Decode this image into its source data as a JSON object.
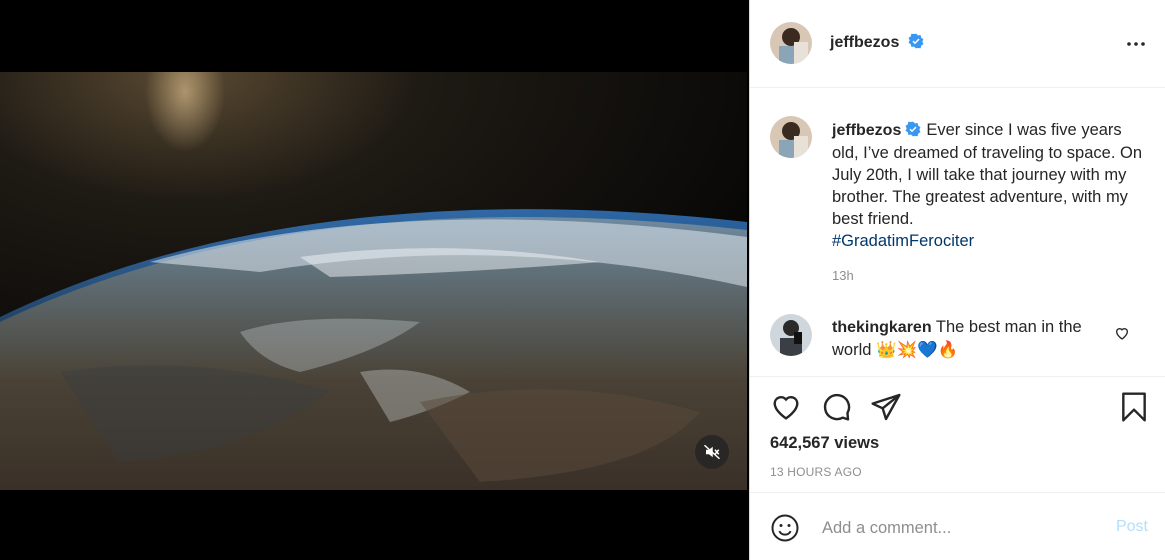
{
  "post": {
    "username": "jeffbezos",
    "verified": true,
    "caption_username": "jeffbezos",
    "caption_text": "Ever since I was five years old, I’ve dreamed of traveling to space. On July 20th, I will take that journey with my brother. The greatest adventure, with my best friend.",
    "hashtag": "#GradatimFerociter",
    "time": "13h",
    "views": "642,567 views",
    "posted_ago": "13 HOURS AGO"
  },
  "comment": {
    "username": "thekingkaren",
    "text": "The best man in the world",
    "emojis": "👑💥💙🔥"
  },
  "add_comment": {
    "placeholder": "Add a comment...",
    "post_label": "Post"
  },
  "colors": {
    "verified_blue": "#3897f0",
    "post_disabled": "#b2dffc",
    "hashtag": "#00376b"
  },
  "icons": [
    "mute-icon",
    "more-icon",
    "heart-icon",
    "comment-icon",
    "share-icon",
    "bookmark-icon",
    "emoji-icon",
    "verified-icon"
  ]
}
